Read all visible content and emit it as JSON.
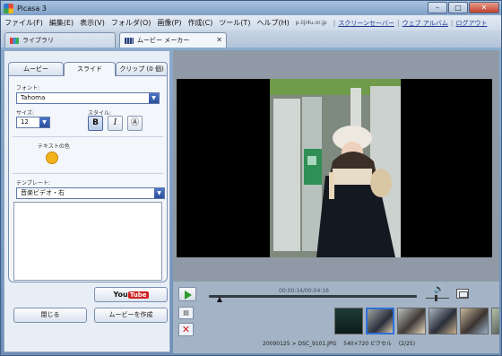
{
  "window": {
    "title": "Picasa 3",
    "btn_min": "–",
    "btn_max": "□",
    "btn_close": "✕"
  },
  "menu": {
    "items": [
      "ファイル(F)",
      "編集(E)",
      "表示(V)",
      "フォルダ(O)",
      "画像(P)",
      "作成(C)",
      "ツール(T)",
      "ヘルプ(H)"
    ],
    "note": "p.iiji4u.or.jp",
    "links": [
      "スクリーンセーバー",
      "ウェブ アルバム",
      "ログアウト"
    ],
    "sep": "|"
  },
  "tabs": {
    "library": "ライブラリ",
    "movie": "ムービー メーカー",
    "close": "✕"
  },
  "panel": {
    "subtabs": [
      "ムービー",
      "スライド",
      "クリップ (0 個)"
    ],
    "font_label": "フォント:",
    "font_value": "Tahoma",
    "size_label": "サイズ:",
    "size_value": "12",
    "style_label": "スタイル:",
    "style_buttons": [
      "B",
      "I",
      "Ⓐ"
    ],
    "text_color_label": "テキストの色",
    "template_label": "テンプレート:",
    "template_value": "音楽ビデオ・右",
    "dropdown_arrow": "▼",
    "youtube_you": "You",
    "youtube_tube": "Tube",
    "close_button": "閉じる",
    "create_button": "ムービーを作成"
  },
  "player": {
    "timecode": "00:00:14/00:04:16",
    "volume_icon": "🔊",
    "textslide_icon": "▤",
    "delete_icon": "✕",
    "progress": 0.05
  },
  "info": {
    "filename": "20090125 > DSC_9101.JPG",
    "dimensions": "540×720 ピクセル",
    "position": "(2/25)"
  },
  "colors": {
    "text_color": "#f2b31c",
    "accent": "#2e6fd8"
  }
}
